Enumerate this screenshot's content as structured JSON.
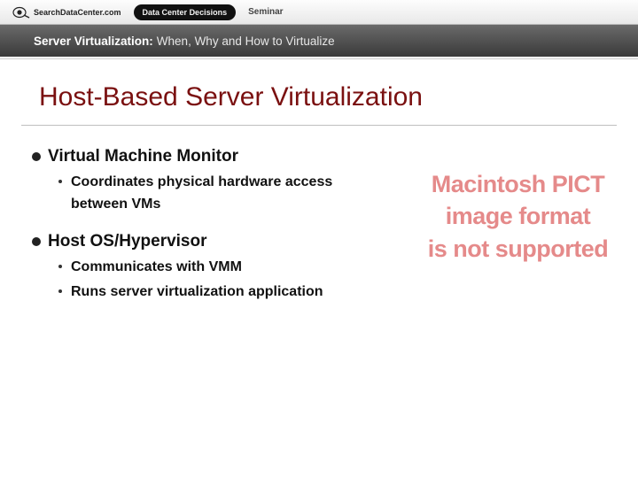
{
  "topbar": {
    "logo_text": "SearchDataCenter.com",
    "pill": "Data Center Decisions",
    "seminar": "Seminar"
  },
  "titlebar": {
    "strong": "Server Virtualization:",
    "rest": "When, Why and How to Virtualize"
  },
  "slide": {
    "title": "Host-Based Server Virtualization",
    "sections": [
      {
        "title": "Virtual Machine Monitor",
        "items": [
          "Coordinates physical hardware access between VMs"
        ]
      },
      {
        "title": "Host OS/Hypervisor",
        "items": [
          "Communicates with VMM",
          "Runs server virtualization application"
        ]
      }
    ]
  },
  "pict_error": {
    "l1": "Macintosh PICT",
    "l2": "image format",
    "l3": "is not supported"
  }
}
